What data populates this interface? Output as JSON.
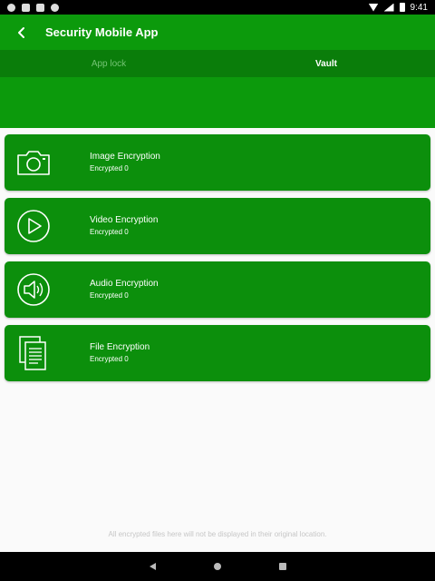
{
  "status_bar": {
    "time": "9:41"
  },
  "app_bar": {
    "title": "Security Mobile App"
  },
  "tabs": [
    {
      "label": "App lock",
      "active": false
    },
    {
      "label": "Vault",
      "active": true
    }
  ],
  "cards": [
    {
      "title": "Image Encryption",
      "subtitle": "Encrypted 0",
      "icon": "camera-icon"
    },
    {
      "title": "Video Encryption",
      "subtitle": "Encrypted 0",
      "icon": "play-icon"
    },
    {
      "title": "Audio Encryption",
      "subtitle": "Encrypted 0",
      "icon": "speaker-icon"
    },
    {
      "title": "File Encryption",
      "subtitle": "Encrypted 0",
      "icon": "document-icon"
    }
  ],
  "footer": {
    "note": "All encrypted files here will not be displayed in their original location."
  },
  "colors": {
    "primary": "#0c9a0c",
    "tab_bar": "#0a7d0a",
    "card": "#0c8f0c"
  }
}
